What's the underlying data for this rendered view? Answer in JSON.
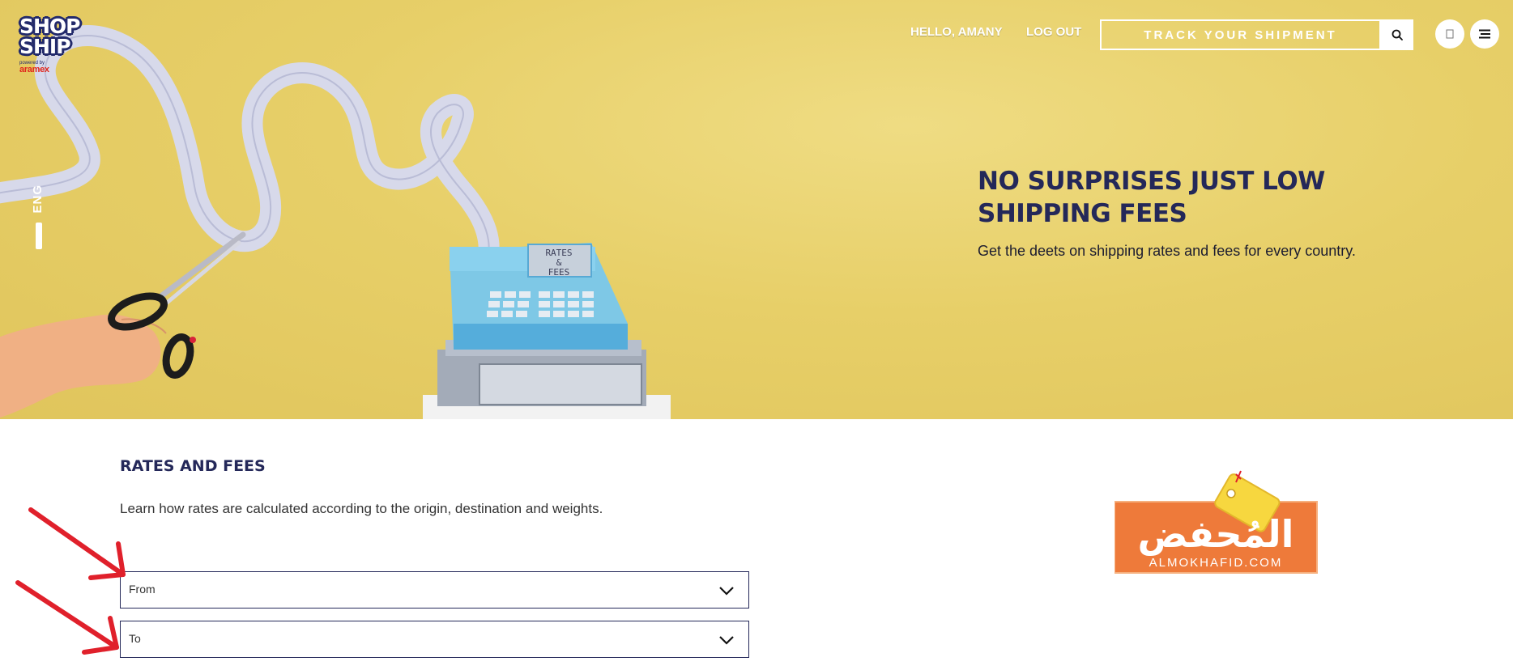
{
  "header": {
    "logo_word_1": "SHOP",
    "logo_word_2": "SHIP",
    "logo_sub": "powered by",
    "logo_brand": "aramex",
    "greeting": "HELLO, AMANY",
    "logout_label": "LOG OUT",
    "track_placeholder": "TRACK YOUR SHIPMENT",
    "icons": [
      "search-icon",
      "info-icon",
      "menu-icon"
    ]
  },
  "sidebar": {
    "language": "ENG"
  },
  "hero": {
    "register_text_line1": "RATES",
    "register_text_line2": "&",
    "register_text_line3": "FEES",
    "title_line1": "NO SURPRISES JUST LOW",
    "title_line2": "SHIPPING FEES",
    "subtitle": "Get the deets on shipping rates and fees for every country."
  },
  "rates": {
    "title": "RATES AND FEES",
    "description": "Learn how rates are calculated according to the origin, destination and weights.",
    "from_label": "From",
    "to_label": "To"
  },
  "partner": {
    "arabic": "المُحفض",
    "latin": "ALMOKHAFID.COM"
  },
  "colors": {
    "hero_bg": "#e5cd66",
    "navy": "#242859",
    "arrow_red": "#e0202b",
    "partner_orange": "#ee7a3a",
    "tag_yellow": "#f7d73f"
  }
}
